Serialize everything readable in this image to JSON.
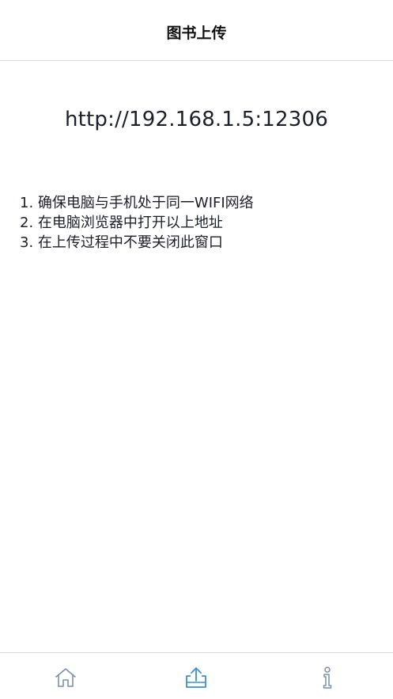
{
  "header": {
    "title": "图书上传"
  },
  "server": {
    "url": "http://192.168.1.5:12306"
  },
  "instructions": [
    "1. 确保电脑与手机处于同一WIFI网络",
    "2. 在电脑浏览器中打开以上地址",
    "3. 在上传过程中不要关闭此窗口"
  ],
  "tabbar": {
    "items": [
      {
        "icon": "home-icon",
        "active": false
      },
      {
        "icon": "upload-icon",
        "active": true
      },
      {
        "icon": "info-icon",
        "active": false
      }
    ]
  },
  "colors": {
    "active_tab": "#3d8fcf",
    "inactive_tab": "#7d8fa8",
    "text": "#1b1f2a"
  }
}
